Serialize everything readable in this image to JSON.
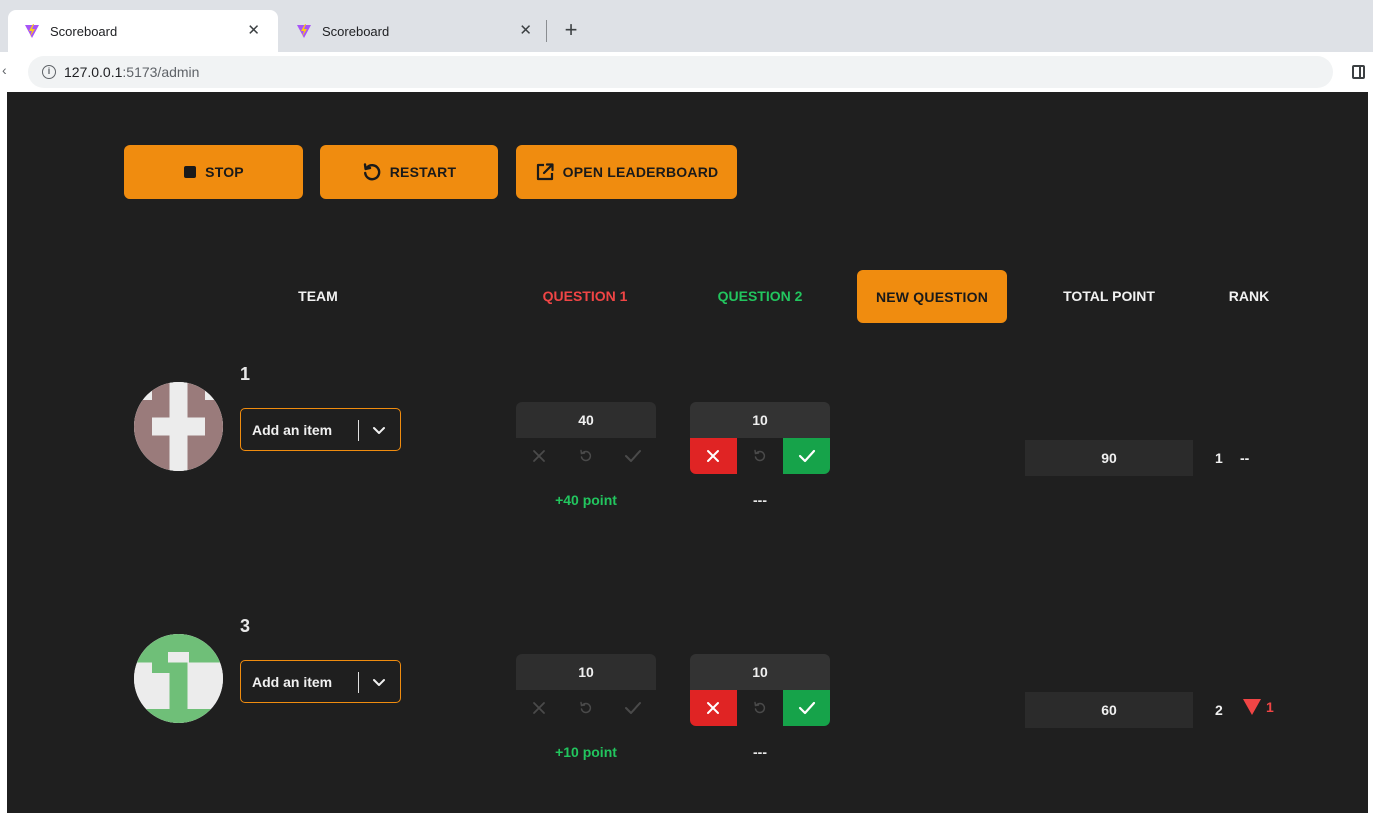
{
  "browser": {
    "tabs": [
      {
        "title": "Scoreboard",
        "active": true
      },
      {
        "title": "Scoreboard",
        "active": false
      }
    ],
    "url_host": "127.0.0.1",
    "url_path": ":5173/admin"
  },
  "controls": {
    "stop_label": "STOP",
    "restart_label": "RESTART",
    "leaderboard_label": "OPEN LEADERBOARD"
  },
  "header": {
    "team": "TEAM",
    "q1": "QUESTION 1",
    "q2": "QUESTION 2",
    "new_question": "NEW QUESTION",
    "total": "TOTAL POINT",
    "rank": "RANK"
  },
  "colors": {
    "accent": "#f08c0f",
    "background": "#1f1f1f",
    "question1": "#f04545",
    "question2": "#22c55e",
    "wrong": "#e02424",
    "correct": "#16a34a"
  },
  "teams": [
    {
      "number": "1",
      "avatar_color": "#9a7b7b",
      "item_placeholder": "Add an item",
      "q1_score": "40",
      "q1_delta": "+40 point",
      "q2_score": "10",
      "q2_delta": "---",
      "total": "90",
      "rank": "1",
      "rank_change": "--"
    },
    {
      "number": "3",
      "avatar_color": "#6fbf78",
      "item_placeholder": "Add an item",
      "q1_score": "10",
      "q1_delta": "+10 point",
      "q2_score": "10",
      "q2_delta": "---",
      "total": "60",
      "rank": "2",
      "rank_change": "1"
    }
  ]
}
